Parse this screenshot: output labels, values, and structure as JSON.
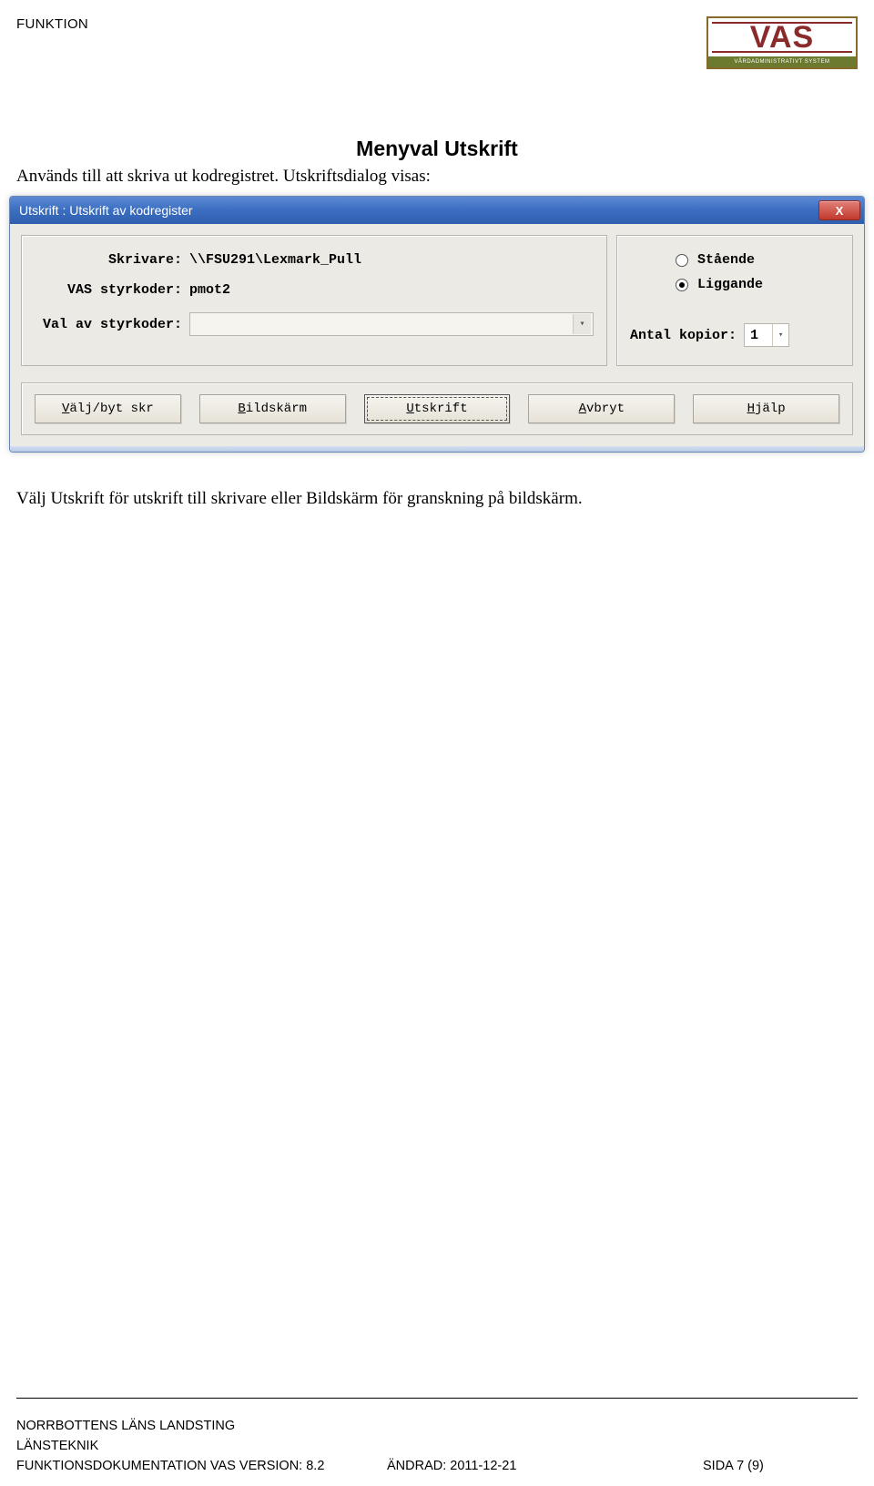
{
  "header": {
    "funktion": "FUNKTION",
    "logo_text": "VAS",
    "logo_sub": "VÅRDADMINISTRATIVT SYSTEM"
  },
  "section_title": "Menyval Utskrift",
  "intro": "Används till att skriva ut kodregistret. Utskriftsdialog visas:",
  "dialog": {
    "title": "Utskrift  : Utskrift av kodregister",
    "close": "X",
    "labels": {
      "skrivare": "Skrivare:",
      "styrkoder": "VAS styrkoder:",
      "val_av_styrkoder": "Val av styrkoder:",
      "antal_kopior": "Antal kopior:"
    },
    "values": {
      "skrivare": "\\\\FSU291\\Lexmark_Pull",
      "styrkoder": "pmot2",
      "val_av_styrkoder": "",
      "antal_kopior": "1"
    },
    "orientation": {
      "staende": "Stående",
      "liggande": "Liggande",
      "selected": "liggande"
    },
    "buttons": {
      "valj_byt": {
        "accel": "V",
        "rest": "älj/byt skr"
      },
      "bildskarm": {
        "accel": "B",
        "rest": "ildskärm"
      },
      "utskrift": {
        "accel": "U",
        "rest": "tskrift"
      },
      "avbryt": {
        "accel": "A",
        "rest": "vbryt"
      },
      "hjalp": {
        "accel": "H",
        "rest": "jälp"
      }
    }
  },
  "post_text": "Välj Utskrift för utskrift till skrivare eller Bildskärm för granskning  på bildskärm.",
  "footer": {
    "org": "NORRBOTTENS LÄNS LANDSTING",
    "dept": "LÄNSTEKNIK",
    "doc": "FUNKTIONSDOKUMENTATION VAS VERSION: 8.2",
    "changed": "ÄNDRAD: 2011-12-21",
    "page": "SIDA 7 (9)"
  }
}
